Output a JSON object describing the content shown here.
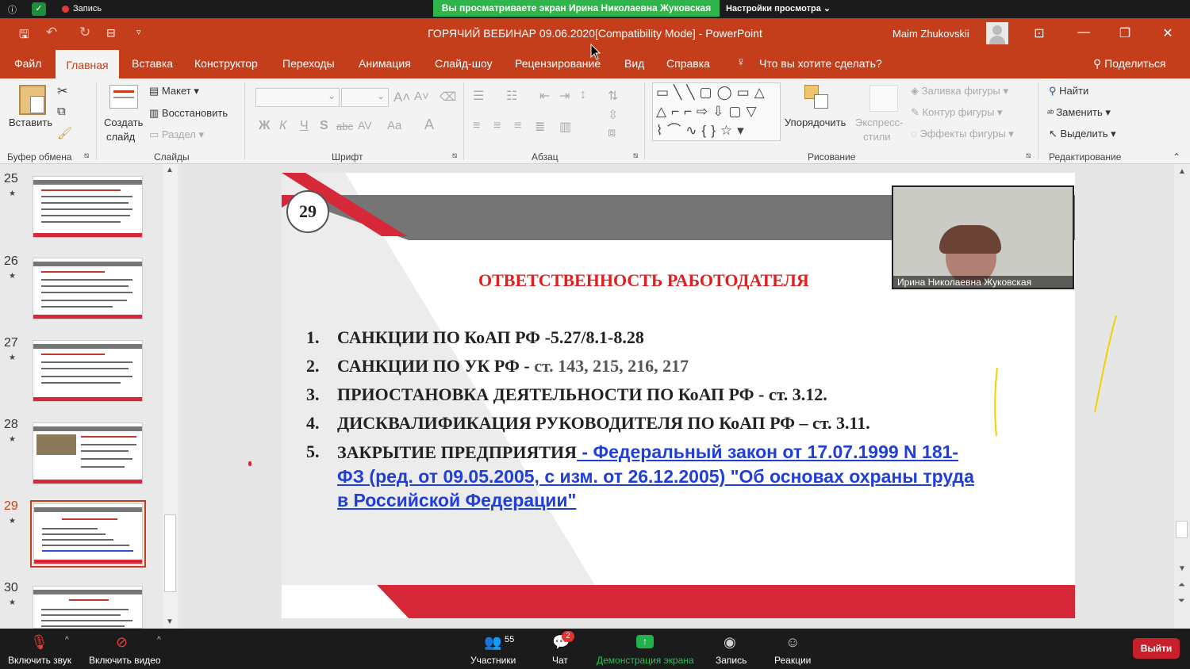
{
  "zoom_top": {
    "record": "Запись",
    "banner": "Вы просматриваете экран Ирина Николаевна Жуковская",
    "view_settings": "Настройки просмотра ⌄"
  },
  "titlebar": {
    "title": "ГОРЯЧИЙ ВЕБИНАР 09.06.2020[Compatibility Mode]  -  PowerPoint",
    "user": "Maim Zhukovskii"
  },
  "tabs": [
    "Файл",
    "Главная",
    "Вставка",
    "Конструктор",
    "Переходы",
    "Анимация",
    "Слайд-шоу",
    "Рецензирование",
    "Вид",
    "Справка"
  ],
  "tell_me": "Что вы хотите сделать?",
  "share": "Поделиться",
  "ribbon": {
    "paste": "Вставить",
    "clipboard": "Буфер обмена",
    "new_slide": "Создать",
    "new_slide2": "слайд",
    "layout": "Макет",
    "reset": "Восстановить",
    "section": "Раздел",
    "slides": "Слайды",
    "font": "Шрифт",
    "paragraph": "Абзац",
    "arrange": "Упорядочить",
    "quick_styles": "Экспресс-",
    "quick_styles2": "стили",
    "shape_fill": "Заливка фигуры",
    "shape_outline": "Контур фигуры",
    "shape_effects": "Эффекты фигуры",
    "drawing": "Рисование",
    "find": "Найти",
    "replace": "Заменить",
    "select": "Выделить",
    "editing": "Редактирование",
    "bold": "Ж",
    "italic": "К",
    "underline": "Ч",
    "shadow": "S",
    "strike": "abc",
    "spacing": "AV",
    "case": "Aa"
  },
  "thumbs": [
    {
      "n": "25"
    },
    {
      "n": "26"
    },
    {
      "n": "27"
    },
    {
      "n": "28"
    },
    {
      "n": "29"
    },
    {
      "n": "30"
    }
  ],
  "slide": {
    "number": "29",
    "title": "ОТВЕТСТВЕННОСТЬ РАБОТОДАТЕЛЯ",
    "items": [
      {
        "n": "1.",
        "text": "САНКЦИИ ПО КоАП РФ -5.27/8.1-8.28"
      },
      {
        "n": "2.",
        "text": "САНКЦИИ ПО УК РФ - ",
        "rest": "ст. 143, 215, 216, 217"
      },
      {
        "n": "3.",
        "text": "ПРИОСТАНОВКА ДЕЯТЕЛЬНОСТИ ПО КоАП РФ  - ст. 3.12."
      },
      {
        "n": "4.",
        "text": "ДИСКВАЛИФИКАЦИЯ РУКОВОДИТЕЛЯ ПО КоАП РФ – ст. 3.11."
      },
      {
        "n": "5.",
        "text": "ЗАКРЫТИЕ  ПРЕДПРИЯТИЯ",
        "link1": " - Федеральный закон от 17.07.1999 N 181-",
        "link2": "ФЗ (ред. от 09.05.2005, с изм. от 26.12.2005) \"Об основах охраны труда",
        "link3": "в Российской Федерации\""
      }
    ]
  },
  "webcam": {
    "name": "Ирина Николаевна Жуковская"
  },
  "zoom_bottom": {
    "mute": "Включить звук",
    "video": "Включить видео",
    "participants": "Участники",
    "participants_count": "55",
    "chat": "Чат",
    "chat_badge": "2",
    "share": "Демонстрация экрана",
    "record": "Запись",
    "reactions": "Реакции",
    "exit": "Выйти"
  }
}
